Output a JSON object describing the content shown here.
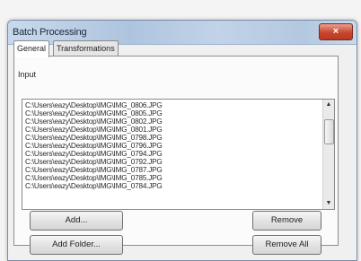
{
  "window": {
    "title": "Batch Processing",
    "close_label": "×"
  },
  "tabs": [
    {
      "label": "General"
    },
    {
      "label": "Transformations"
    }
  ],
  "input": {
    "label": "Input",
    "files": [
      "C:\\Users\\eazy\\Desktop\\IMG\\IMG_0806.JPG",
      "C:\\Users\\eazy\\Desktop\\IMG\\IMG_0805.JPG",
      "C:\\Users\\eazy\\Desktop\\IMG\\IMG_0802.JPG",
      "C:\\Users\\eazy\\Desktop\\IMG\\IMG_0801.JPG",
      "C:\\Users\\eazy\\Desktop\\IMG\\IMG_0798.JPG",
      "C:\\Users\\eazy\\Desktop\\IMG\\IMG_0796.JPG",
      "C:\\Users\\eazy\\Desktop\\IMG\\IMG_0794.JPG",
      "C:\\Users\\eazy\\Desktop\\IMG\\IMG_0792.JPG",
      "C:\\Users\\eazy\\Desktop\\IMG\\IMG_0787.JPG",
      "C:\\Users\\eazy\\Desktop\\IMG\\IMG_0785.JPG",
      "C:\\Users\\eazy\\Desktop\\IMG\\IMG_0784.JPG"
    ]
  },
  "buttons": {
    "add": "Add...",
    "add_folder": "Add Folder...",
    "remove": "Remove",
    "remove_all": "Remove All"
  },
  "icons": {
    "scroll_up": "up-arrow-icon",
    "scroll_down": "down-arrow-icon"
  }
}
